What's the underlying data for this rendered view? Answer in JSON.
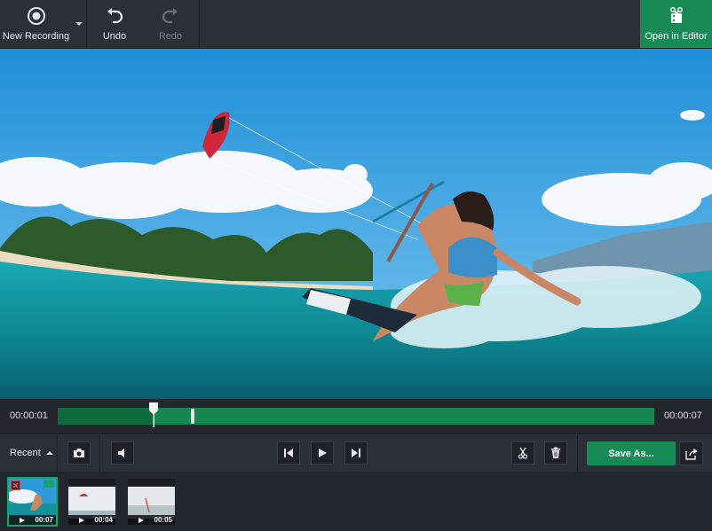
{
  "toolbar": {
    "new_recording_label": "New Recording",
    "undo_label": "Undo",
    "redo_label": "Redo",
    "open_editor_label": "Open in Editor",
    "accent": "#178a56"
  },
  "timeline": {
    "current_time": "00:00:01",
    "total_time": "00:00:07",
    "played_fraction": 0.16
  },
  "controls": {
    "recent_label": "Recent",
    "save_as_label": "Save As...",
    "icons": [
      "camera-icon",
      "speaker-icon",
      "skip-back-icon",
      "play-icon",
      "skip-forward-icon",
      "scissors-icon",
      "trash-icon",
      "share-icon"
    ]
  },
  "recent": {
    "items": [
      {
        "duration": "00:07",
        "selected": true
      },
      {
        "duration": "00:04",
        "selected": false
      },
      {
        "duration": "00:05",
        "selected": false
      }
    ]
  }
}
